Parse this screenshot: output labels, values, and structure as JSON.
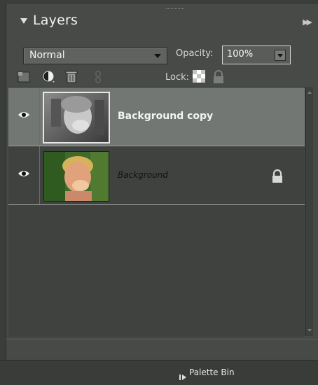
{
  "panel": {
    "title": "Layers",
    "menu_icon": "double-triangle-right"
  },
  "blend_mode": {
    "value": "Normal"
  },
  "opacity": {
    "label": "Opacity:",
    "value": "100%"
  },
  "toolbar": {
    "icons": [
      "new-layer-icon",
      "adjustment-layer-icon",
      "trash-icon",
      "link-icon"
    ],
    "lock_label": "Lock:",
    "lock_icons": [
      "lock-transparent-icon",
      "lock-all-icon"
    ]
  },
  "layers": [
    {
      "name": "Background copy",
      "visible": true,
      "selected": true,
      "locked": false,
      "thumb": "grayscale"
    },
    {
      "name": "Background",
      "visible": true,
      "selected": false,
      "locked": true,
      "thumb": "color"
    }
  ],
  "footer": {
    "palette_bin_label": "Palette Bin"
  },
  "colors": {
    "panel": "#474a47",
    "selected_row": "#727773",
    "list_bg": "#40423f"
  }
}
